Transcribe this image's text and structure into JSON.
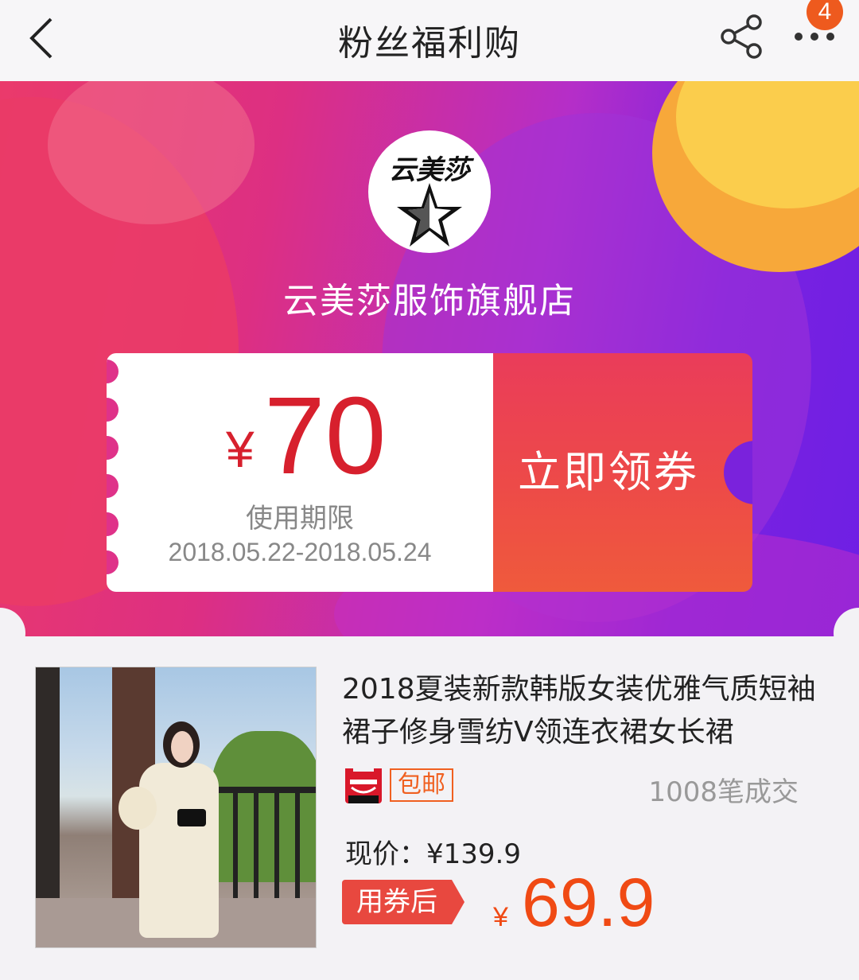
{
  "nav": {
    "title": "粉丝福利购",
    "badge_count": "4",
    "icons": [
      "chevron-left-icon",
      "share-icon",
      "more-icon"
    ]
  },
  "store": {
    "logo_text": "云美莎",
    "name": "云美莎服饰旗舰店"
  },
  "coupon": {
    "currency": "¥",
    "amount": "70",
    "validity_label": "使用期限",
    "validity_dates": "2018.05.22-2018.05.24",
    "claim_label": "立即领券"
  },
  "product": {
    "title": "2018夏装新款韩版女装优雅气质短袖裙子修身雪纺V领连衣裙女长裙",
    "free_shipping": "包邮",
    "sales": "1008笔成交",
    "current_price_label": "现价：¥139.9",
    "after_coupon_label": "用券后",
    "after_coupon_currency": "¥",
    "after_coupon_price": "69.9"
  },
  "colors": {
    "accent_red": "#d7202d",
    "price_orange": "#f04a14",
    "badge_orange": "#ee5a1e"
  }
}
